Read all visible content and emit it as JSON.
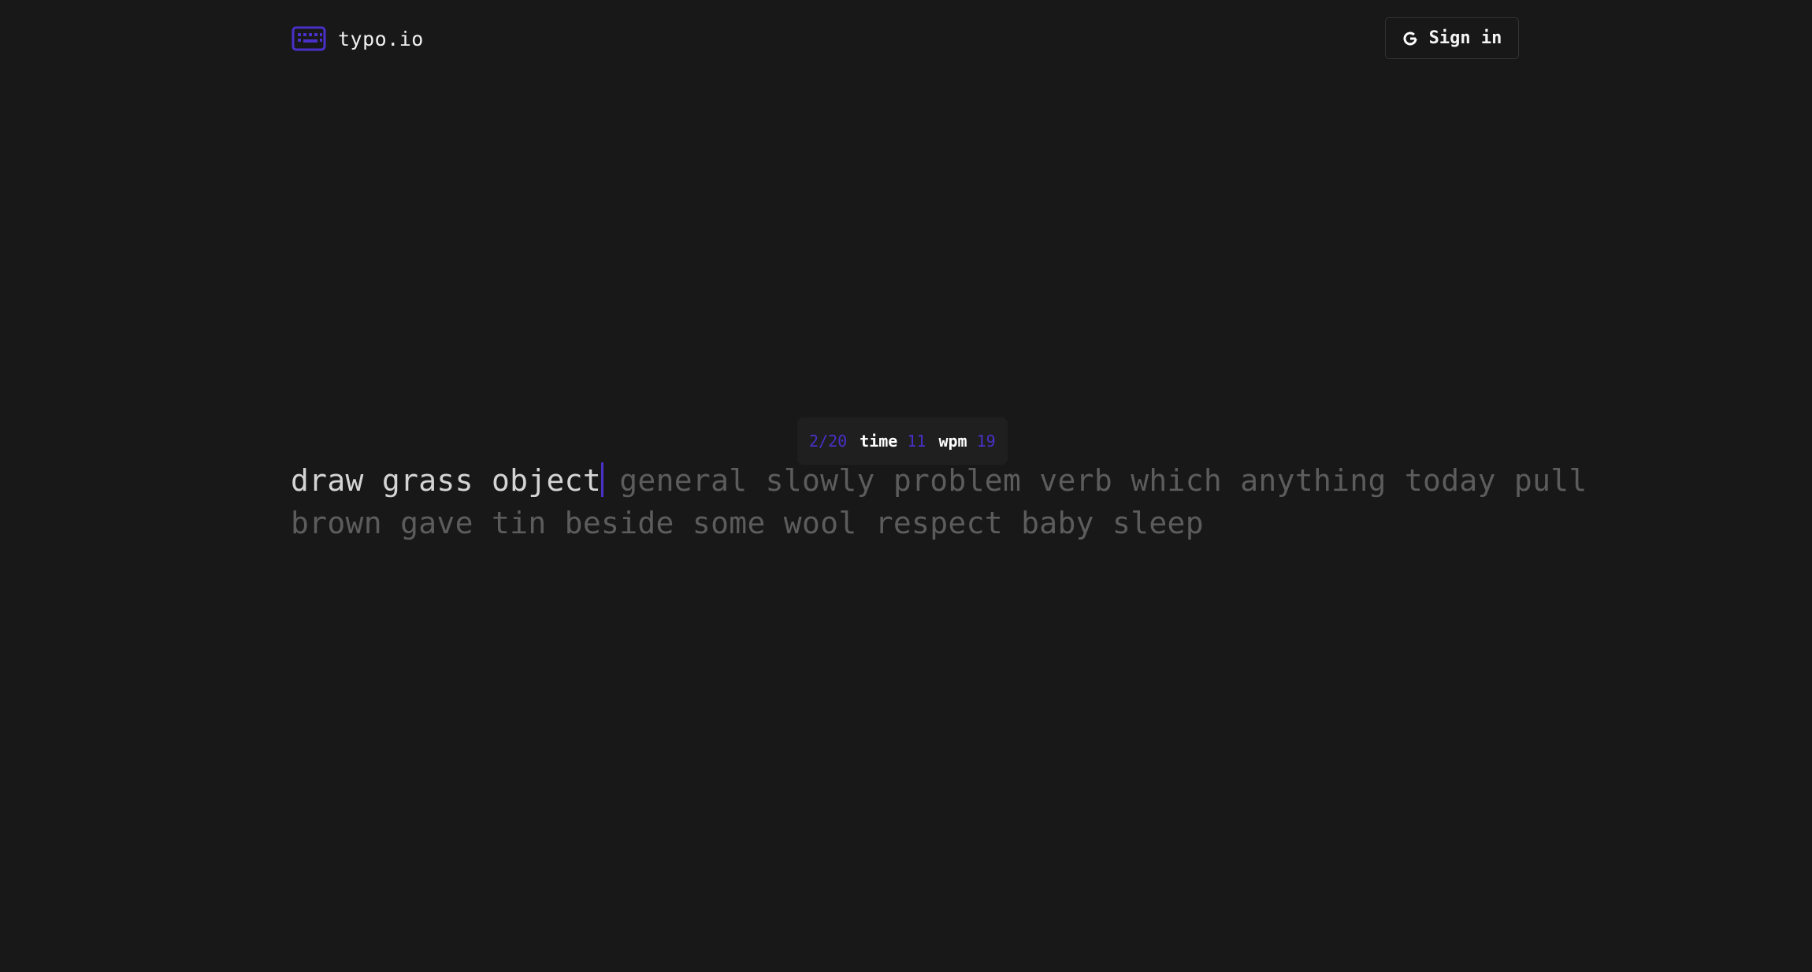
{
  "header": {
    "logo_icon": "keyboard-icon",
    "logo_text": "typo.io",
    "signin_icon": "google-icon",
    "signin_label": "Sign in"
  },
  "stats": {
    "progress": "2/20",
    "time_label": "time",
    "time_value": "11",
    "wpm_label": "wpm",
    "wpm_value": "19"
  },
  "typing": {
    "typed_text": "draw grass object",
    "line1_remaining": " general slowly problem verb which anything today pull",
    "line2": "brown gave tin beside some wool respect baby sleep"
  },
  "colors": {
    "background": "#181818",
    "accent": "#4a30c8",
    "typed_text": "#d4d4d4",
    "untyped_text": "#5c5c5c"
  }
}
